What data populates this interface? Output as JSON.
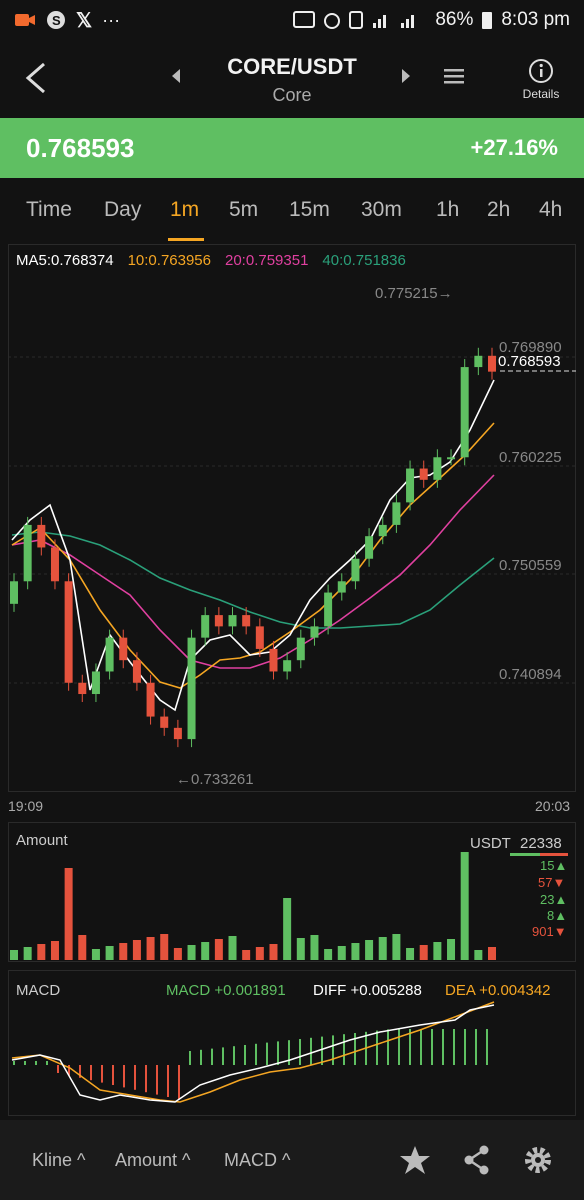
{
  "status": {
    "battery": "86%",
    "time": "8:03 pm"
  },
  "header": {
    "pair": "CORE/USDT",
    "name": "Core",
    "details_label": "Details"
  },
  "price": {
    "last": "0.768593",
    "change": "+27.16%"
  },
  "tabs": [
    "Time",
    "Day",
    "1m",
    "5m",
    "15m",
    "30m",
    "1h",
    "2h",
    "4h"
  ],
  "active_tab": "1m",
  "ma": {
    "ma5": "MA5:0.768374",
    "ma10": "10:0.763956",
    "ma20": "20:0.759351",
    "ma40": "40:0.751836"
  },
  "axis": {
    "y1": "0.769890",
    "y2": "0.760225",
    "y3": "0.750559",
    "y4": "0.740894",
    "current": "0.768593",
    "high": "0.775215→",
    "low": "←0.733261",
    "t_start": "19:09",
    "t_end": "20:03"
  },
  "amount": {
    "title": "Amount",
    "unit": "USDT",
    "value": "22338",
    "list": [
      "15▲",
      "57▼",
      "23▲",
      "8▲",
      "901▼"
    ]
  },
  "macd": {
    "title": "MACD",
    "macd": "MACD +0.001891",
    "diff": "DIFF +0.005288",
    "dea": "DEA +0.004342"
  },
  "bottom": {
    "kline": "Kline ^",
    "amount": "Amount ^",
    "macd": "MACD ^"
  },
  "colors": {
    "up": "#5fbf62",
    "down": "#e5533d",
    "ma5": "#ffffff",
    "ma10": "#f5a623",
    "ma20": "#e040a0",
    "ma40": "#2aa07a",
    "bg": "#121212"
  },
  "chart_data": {
    "type": "candlestick",
    "y_range": [
      0.733261,
      0.775215
    ],
    "candles_close": [
      0.75,
      0.755,
      0.753,
      0.75,
      0.741,
      0.74,
      0.742,
      0.745,
      0.743,
      0.741,
      0.738,
      0.737,
      0.736,
      0.745,
      0.747,
      0.746,
      0.747,
      0.746,
      0.744,
      0.742,
      0.743,
      0.745,
      0.746,
      0.749,
      0.75,
      0.752,
      0.754,
      0.755,
      0.757,
      0.76,
      0.759,
      0.761,
      0.761,
      0.769,
      0.77,
      0.768593
    ]
  }
}
